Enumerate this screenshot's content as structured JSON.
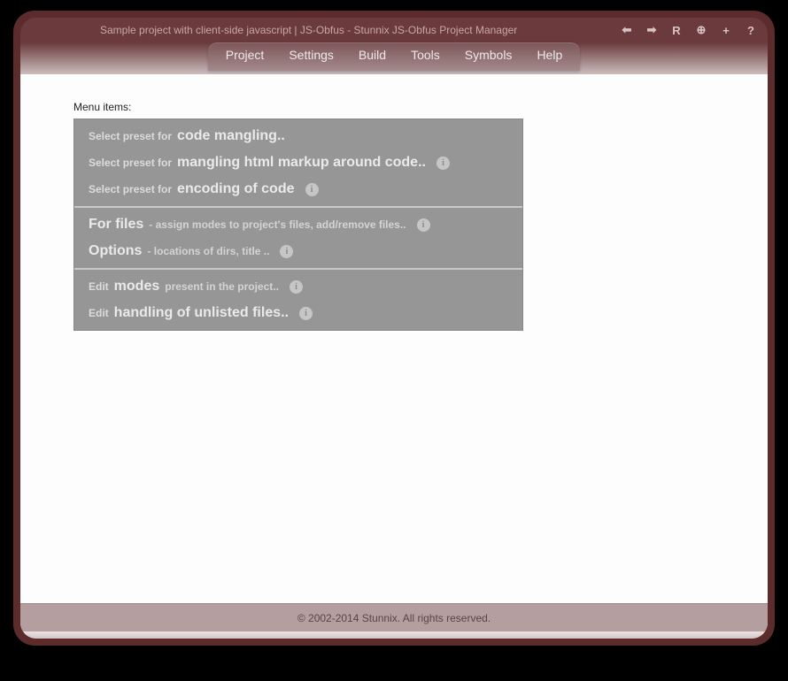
{
  "title": "Sample project with client-side javascript | JS-Obfus - Stunnix JS-Obfus Project Manager",
  "toolbar_icons": {
    "back": "⬅",
    "forward": "➡",
    "reload": "R",
    "zoom": "⊕",
    "add": "+",
    "help": "?"
  },
  "menubar": [
    "Project",
    "Settings",
    "Build",
    "Tools",
    "Symbols",
    "Help"
  ],
  "content": {
    "heading": "Menu items:",
    "groups": [
      {
        "rows": [
          {
            "prefix": "Select preset for",
            "main": "code mangling..",
            "suffix": "",
            "info": false
          },
          {
            "prefix": "Select preset for",
            "main": "mangling html markup around code..",
            "suffix": "",
            "info": true
          },
          {
            "prefix": "Select preset for",
            "main": "encoding of code",
            "suffix": "",
            "info": true
          }
        ]
      },
      {
        "rows": [
          {
            "prefix": "",
            "main": "For files",
            "suffix": "- assign modes to project's files, add/remove files..",
            "info": true
          },
          {
            "prefix": "",
            "main": "Options",
            "suffix": "- locations of dirs, title ..",
            "info": true
          }
        ]
      },
      {
        "rows": [
          {
            "prefix": "Edit",
            "main": "modes",
            "suffix": "present in the project..",
            "info": true
          },
          {
            "prefix": "Edit",
            "main": "handling of unlisted files..",
            "suffix": "",
            "info": true
          }
        ]
      }
    ]
  },
  "footer": "© 2002-2014 Stunnix. All rights reserved."
}
